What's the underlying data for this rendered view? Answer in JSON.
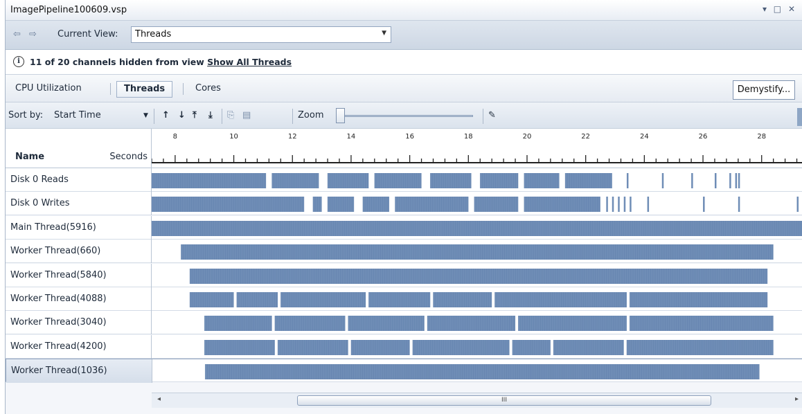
{
  "window": {
    "title": "ImagePipeline100609.vsp",
    "controls": "▾ □ ✕"
  },
  "viewbar": {
    "nav_arrows": "⇦ ⇨",
    "current_view_label": "Current View:",
    "current_view_value": "Threads"
  },
  "info": {
    "message": "11 of 20  channels hidden from view",
    "link": "Show All Threads"
  },
  "tabs": [
    {
      "label": "CPU Utilization",
      "active": false
    },
    {
      "label": "Threads",
      "active": true
    },
    {
      "label": "Cores",
      "active": false
    }
  ],
  "demystify_label": "Demystify...",
  "toolbar": {
    "sort_by_label": "Sort by:",
    "sort_by_value": "Start Time",
    "zoom_label": "Zoom",
    "zoom_level": 0
  },
  "header": {
    "name": "Name",
    "seconds": "Seconds"
  },
  "ruler": {
    "ticks": [
      "8",
      "10",
      "12",
      "14",
      "16",
      "18",
      "20",
      "22",
      "24",
      "26",
      "28"
    ],
    "start_seconds": 7.2,
    "end_seconds": 29.4
  },
  "threads": [
    {
      "name": "Disk 0 Reads",
      "segments": [
        [
          7.2,
          11.1
        ],
        [
          11.3,
          12.9
        ],
        [
          13.2,
          14.6
        ],
        [
          14.8,
          16.4
        ],
        [
          16.7,
          18.1
        ],
        [
          18.4,
          19.7
        ],
        [
          19.9,
          21.1
        ],
        [
          21.3,
          22.9
        ]
      ],
      "ticks": [
        23.4,
        24.6,
        25.6,
        26.4,
        26.9,
        27.1,
        27.2
      ]
    },
    {
      "name": "Disk 0 Writes",
      "segments": [
        [
          7.2,
          12.4
        ],
        [
          12.7,
          13.0
        ],
        [
          13.2,
          14.1
        ],
        [
          14.4,
          15.3
        ],
        [
          15.5,
          18.0
        ],
        [
          18.2,
          19.7
        ],
        [
          19.9,
          22.5
        ]
      ],
      "ticks": [
        22.7,
        22.9,
        23.1,
        23.3,
        23.5,
        24.1,
        26.0,
        27.2,
        29.2
      ]
    },
    {
      "name": "Main Thread(5916)",
      "segments": [
        [
          7.2,
          29.4
        ]
      ],
      "ticks": []
    },
    {
      "name": "Worker Thread(660)",
      "segments": [
        [
          8.2,
          28.4
        ]
      ],
      "ticks": []
    },
    {
      "name": "Worker Thread(5840)",
      "segments": [
        [
          8.5,
          28.2
        ]
      ],
      "ticks": []
    },
    {
      "name": "Worker Thread(4088)",
      "segments": [
        [
          8.5,
          10.0
        ],
        [
          10.1,
          11.5
        ],
        [
          11.6,
          14.5
        ],
        [
          14.6,
          16.7
        ],
        [
          16.8,
          18.8
        ],
        [
          18.9,
          23.4
        ],
        [
          23.5,
          28.2
        ]
      ],
      "ticks": []
    },
    {
      "name": "Worker Thread(3040)",
      "segments": [
        [
          9.0,
          11.3
        ],
        [
          11.4,
          13.8
        ],
        [
          13.9,
          16.5
        ],
        [
          16.6,
          19.6
        ],
        [
          19.7,
          23.4
        ],
        [
          23.5,
          28.4
        ]
      ],
      "ticks": []
    },
    {
      "name": "Worker Thread(4200)",
      "segments": [
        [
          9.0,
          11.4
        ],
        [
          11.5,
          13.9
        ],
        [
          14.0,
          16.0
        ],
        [
          16.1,
          19.4
        ],
        [
          19.5,
          20.8
        ],
        [
          20.9,
          23.3
        ],
        [
          23.4,
          28.4
        ]
      ],
      "ticks": []
    },
    {
      "name": "Worker Thread(1036)",
      "segments": [
        [
          9.0,
          27.9
        ]
      ],
      "ticks": []
    }
  ],
  "colors": {
    "bar": "#6f8db6",
    "bar_dark": "#5a7aa6",
    "ruler": "#222"
  }
}
